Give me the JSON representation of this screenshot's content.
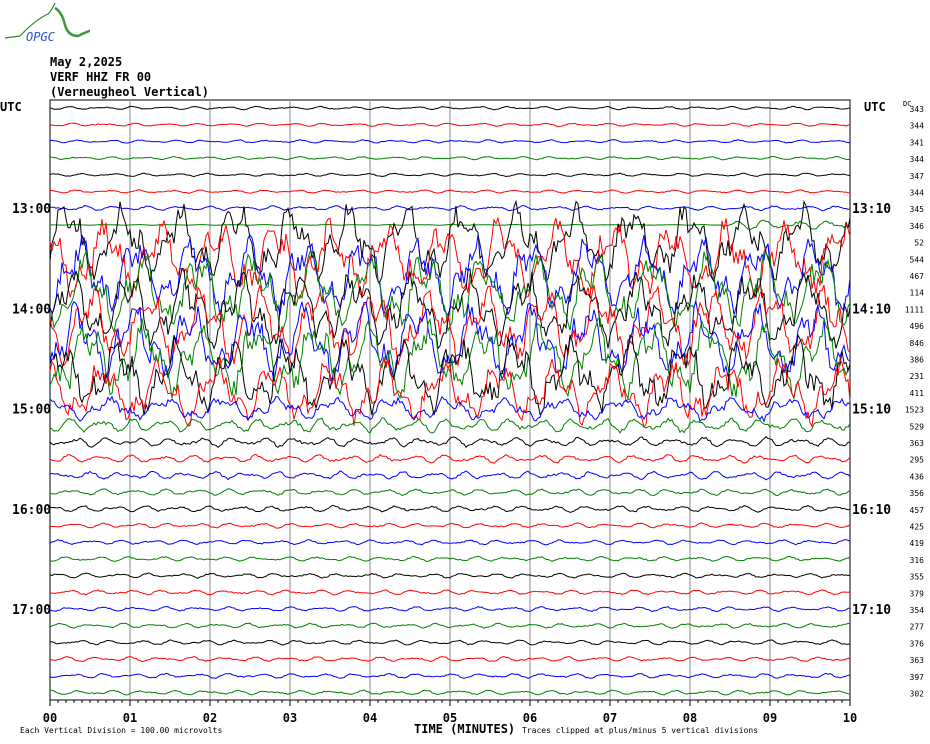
{
  "logo": {
    "text": "OPGC"
  },
  "header": {
    "date": "May 2,2025",
    "channel": "VERF HHZ FR 00",
    "station_name": "(Verneugheol Vertical)"
  },
  "chart_data": {
    "type": "line",
    "subtype": "helicorder",
    "left_axis_label": "UTC",
    "right_axis_label": "UTC",
    "dc_label": "DC",
    "left_hour_labels": [
      {
        "trace": 6,
        "label": "13:00"
      },
      {
        "trace": 12,
        "label": "14:00"
      },
      {
        "trace": 18,
        "label": "15:00"
      },
      {
        "trace": 24,
        "label": "16:00"
      },
      {
        "trace": 30,
        "label": "17:00"
      }
    ],
    "right_hour_labels": [
      {
        "trace": 6,
        "label": "13:10"
      },
      {
        "trace": 12,
        "label": "14:10"
      },
      {
        "trace": 18,
        "label": "15:10"
      },
      {
        "trace": 24,
        "label": "16:10"
      },
      {
        "trace": 30,
        "label": "17:10"
      }
    ],
    "dc_values": [
      "343",
      "344",
      "341",
      "344",
      "347",
      "344",
      "345",
      "346",
      "52",
      "544",
      "467",
      "114",
      "1111",
      "496",
      "846",
      "386",
      "231",
      "411",
      "1523",
      "529",
      "363",
      "295",
      "436",
      "356",
      "457",
      "425",
      "419",
      "316",
      "355",
      "379",
      "354",
      "277",
      "376",
      "363",
      "397",
      "302"
    ],
    "relative_amplitude_divisions": [
      0.2,
      0.2,
      0.2,
      0.2,
      0.2,
      0.2,
      0.3,
      0.6,
      5,
      5,
      5,
      5,
      5,
      5,
      5,
      5,
      5,
      4,
      1.5,
      0.9,
      0.6,
      0.5,
      0.5,
      0.4,
      0.4,
      0.3,
      0.3,
      0.3,
      0.3,
      0.3,
      0.3,
      0.3,
      0.3,
      0.3,
      0.3,
      0.3
    ],
    "trace_colors": [
      "#000000",
      "#ff0000",
      "#0000ff",
      "#008000"
    ],
    "x_ticks": [
      "00",
      "01",
      "02",
      "03",
      "04",
      "05",
      "06",
      "07",
      "08",
      "09",
      "10"
    ],
    "xlim": [
      0,
      10
    ],
    "xlabel": "TIME (MINUTES)",
    "scale_note": "Each Vertical Division =  100.00 microvolts",
    "clip_note": "Traces clipped at plus/minus 5 vertical divisions"
  }
}
